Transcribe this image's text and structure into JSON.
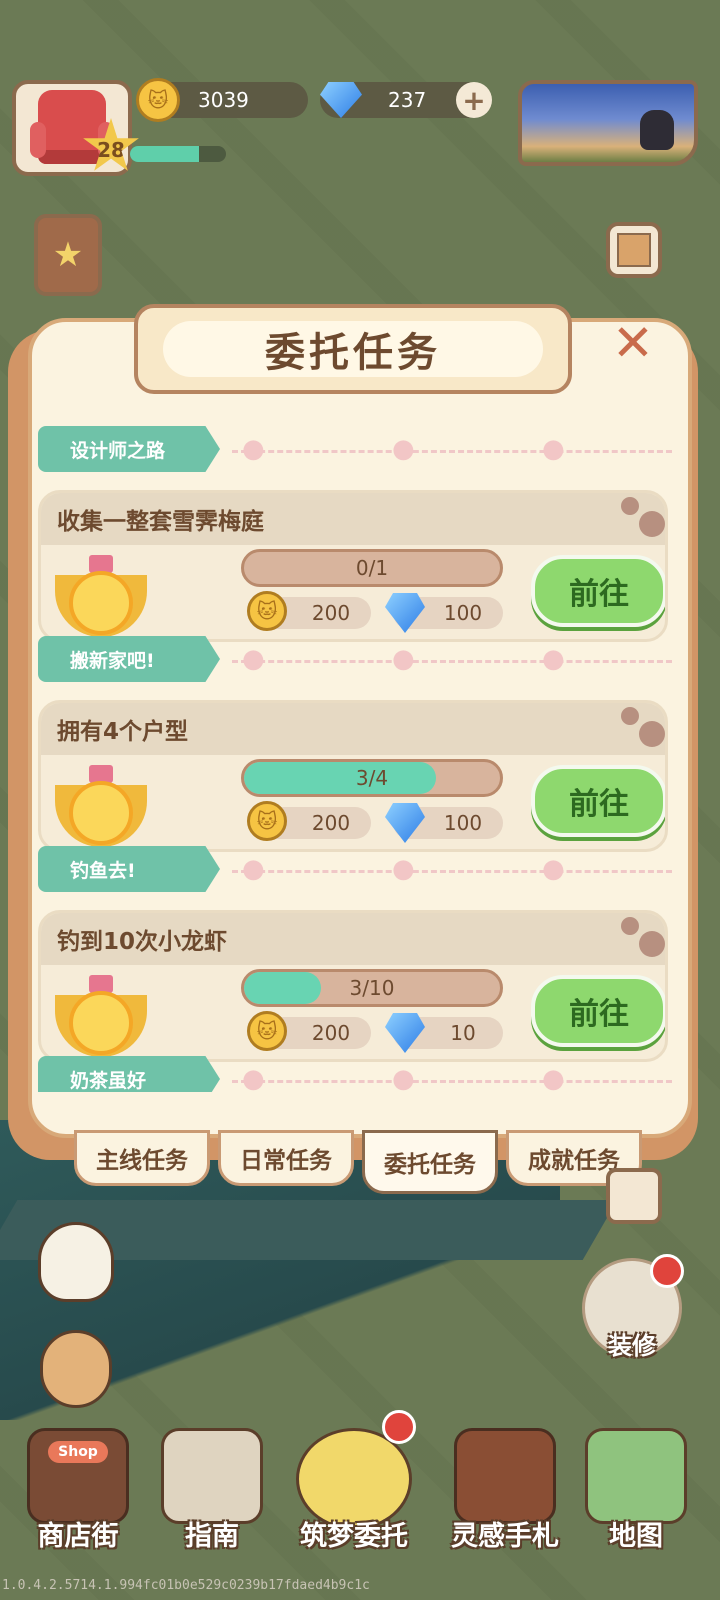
{
  "hud": {
    "level": "28",
    "xp_progress": 0.72,
    "coins": "3039",
    "gems": "237",
    "gems_add_icon": "plus-icon"
  },
  "panel": {
    "title": "委托任务",
    "close_icon": "close-x-icon",
    "sections": [
      {
        "ribbon": "设计师之路",
        "task": {
          "title": "收集一整套雪霁梅庭",
          "progress_text": "0/1",
          "progress": 0.0,
          "coin_reward": "200",
          "gem_reward": "100",
          "button": "前往"
        }
      },
      {
        "ribbon": "搬新家吧!",
        "task": {
          "title": "拥有4个户型",
          "progress_text": "3/4",
          "progress": 0.75,
          "coin_reward": "200",
          "gem_reward": "100",
          "button": "前往"
        }
      },
      {
        "ribbon": "钓鱼去!",
        "task": {
          "title": "钓到10次小龙虾",
          "progress_text": "3/10",
          "progress": 0.3,
          "coin_reward": "200",
          "gem_reward": "10",
          "button": "前往"
        }
      },
      {
        "ribbon": "奶茶虽好"
      }
    ]
  },
  "tabs": [
    {
      "label": "主线任务",
      "active": false
    },
    {
      "label": "日常任务",
      "active": false
    },
    {
      "label": "委托任务",
      "active": true
    },
    {
      "label": "成就任务",
      "active": false
    }
  ],
  "side": {
    "decorate_label": "装修"
  },
  "bottom_nav": [
    {
      "label": "商店街",
      "icon": "shop-icon",
      "sign": "Shop"
    },
    {
      "label": "指南",
      "icon": "guide-book-icon"
    },
    {
      "label": "筑梦委托",
      "icon": "notebook-icon"
    },
    {
      "label": "灵感手札",
      "icon": "journal-icon"
    },
    {
      "label": "地图",
      "icon": "map-pin-icon"
    }
  ],
  "version": "1.0.4.2.5714.1.994fc01b0e529c0239b17fdaed4b9c1c",
  "colors": {
    "accent_green": "#8ed86e",
    "ribbon_teal": "#6fc2a8",
    "progress_fill": "#68d4b2",
    "panel_bg": "#fbf3e0"
  }
}
